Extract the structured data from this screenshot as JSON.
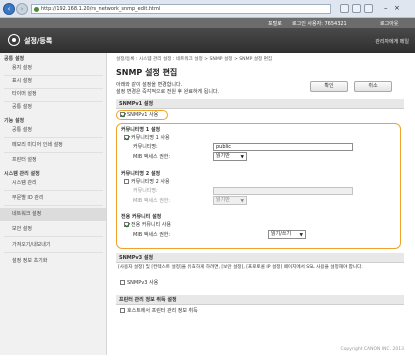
{
  "browser": {
    "back_icon": "back-arrow-icon",
    "forward_icon": "forward-arrow-icon",
    "url": "http://192.168.1.20/rs_network_snmp_edit.html"
  },
  "top_strip": {
    "left": "포털로",
    "middle": "로그인 사용자: 7654321",
    "right": "로그아웃"
  },
  "header": {
    "title": "설정/등록",
    "right_link": "관리자에게 메일"
  },
  "sidebar": {
    "groups": [
      {
        "label": "공통 설정",
        "items": [
          "용지 설정",
          "표시 설정",
          "타이머 설정",
          "공통 설정"
        ]
      },
      {
        "label": "기능 설정",
        "items": [
          "공통 설정",
          "메모리 미디어 인쇄 설정",
          "프린터 설정"
        ]
      },
      {
        "label": "시스템 관리 설정",
        "items": [
          "시스템 관리",
          "부문별 ID 관리",
          "네트워크 설정",
          "보안 설정",
          "가져오기/내보내기",
          "설정 정보 초기화"
        ]
      }
    ],
    "active_item": "네트워크 설정"
  },
  "main": {
    "breadcrumb": "설정/등록 : 시스템 관리 설정 : 네트워크 설정 > SNMP 설정 > SNMP 설정 편집",
    "title": "SNMP 설정 편집",
    "info_line1": "아래와 같이 설정을 변경합니다.",
    "info_line2": "설정 변경은 즉각적으로 전원 후 완료하게 됩니다.",
    "ok_label": "확인",
    "cancel_label": "취소",
    "snmpv1": {
      "section_title": "SNMPv1 설정",
      "use_label": "SNMPv1 사용",
      "use_checked": true,
      "community1_title": "커뮤니티명 1 설정",
      "community1_use_label": "커뮤니티명 1 사용",
      "community1_use_checked": true,
      "community_name_label": "커뮤니티명:",
      "community1_name": "public",
      "mib_access_label": "MIB 액세스 권한:",
      "community1_mib": "읽기만",
      "community2_title": "커뮤니티명 2 설정",
      "community2_use_label": "커뮤니티명 2 사용",
      "community2_use_checked": false,
      "community2_name": "",
      "community2_mib": "읽기만",
      "dedicated_title": "전용 커뮤니티 설정",
      "dedicated_use_label": "전용 커뮤니티 사용",
      "dedicated_use_checked": true,
      "dedicated_mib": "읽기/쓰기"
    },
    "snmpv3": {
      "section_title": "SNMPv3 설정",
      "note": "[사용자 설정] 및 [컨텍스트 설정]을 유효하게 하려면, [보안 설정], [프로토콜 IP 설정] 페이지에서 SSL 사용을 설정해야 합니다.",
      "use_label": "SNMPv3 사용",
      "use_checked": false
    },
    "printer_mgmt": {
      "section_title": "프린터 관리 정보 취득 설정",
      "use_label": "호스트에서 프린터 관리 정보 취득",
      "use_checked": false
    },
    "footer": "Copyright CANON INC. 2013"
  },
  "colors": {
    "highlight": "#f0a22a",
    "header_bg": "#3a3a3a",
    "accent": "#3a78c2"
  }
}
